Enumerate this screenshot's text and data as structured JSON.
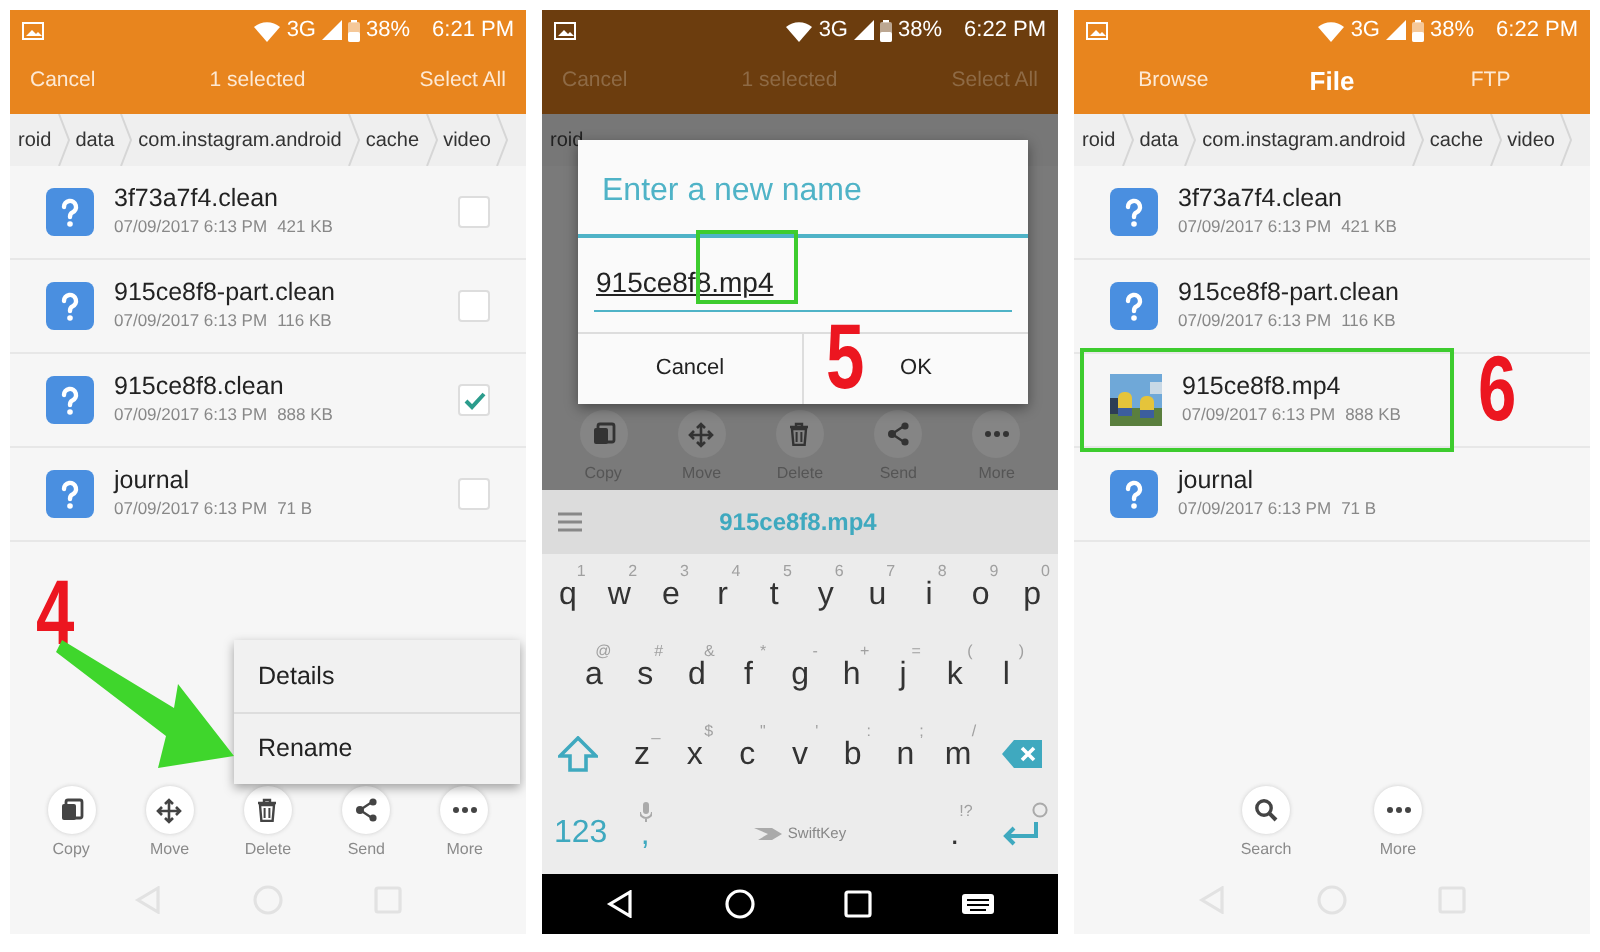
{
  "panels": [
    {
      "kind": "selection",
      "step": "4",
      "status_bar": {
        "network": "3G",
        "battery": "38%",
        "time": "6:21 PM"
      },
      "app_bar": {
        "left": "Cancel",
        "title": "1 selected",
        "right": "Select All"
      },
      "breadcrumb": [
        "roid",
        "data",
        "com.instagram.android",
        "cache",
        "video"
      ],
      "files": [
        {
          "name": "3f73a7f4.clean",
          "date": "07/09/2017 6:13 PM",
          "size": "421 KB",
          "kind": "unknown",
          "checked": false
        },
        {
          "name": "915ce8f8-part.clean",
          "date": "07/09/2017 6:13 PM",
          "size": "116 KB",
          "kind": "unknown",
          "checked": false
        },
        {
          "name": "915ce8f8.clean",
          "date": "07/09/2017 6:13 PM",
          "size": "888 KB",
          "kind": "unknown",
          "checked": true
        },
        {
          "name": "journal",
          "date": "07/09/2017 6:13 PM",
          "size": "71 B",
          "kind": "unknown",
          "checked": false
        }
      ],
      "context_menu": [
        "Details",
        "Rename"
      ],
      "toolbar": [
        {
          "kind": "copy",
          "label": "Copy"
        },
        {
          "kind": "move",
          "label": "Move"
        },
        {
          "kind": "delete",
          "label": "Delete"
        },
        {
          "kind": "send",
          "label": "Send"
        },
        {
          "kind": "more",
          "label": "More"
        }
      ]
    },
    {
      "kind": "rename",
      "step": "5",
      "status_bar": {
        "network": "3G",
        "battery": "38%",
        "time": "6:22 PM"
      },
      "app_bar": {
        "left": "Cancel",
        "title": "1 selected",
        "right": "Select All"
      },
      "breadcrumb": [
        "roid"
      ],
      "dialog": {
        "title": "Enter a new name",
        "value": "915ce8f8.mp4",
        "highlighted": true,
        "buttons": [
          "Cancel",
          "OK"
        ]
      },
      "toolbar": [
        {
          "kind": "copy",
          "label": "Copy"
        },
        {
          "kind": "move",
          "label": "Move"
        },
        {
          "kind": "delete",
          "label": "Delete"
        },
        {
          "kind": "send",
          "label": "Send"
        },
        {
          "kind": "more",
          "label": "More"
        }
      ],
      "keyboard": {
        "suggestion": "915ce8f8.mp4",
        "rows": [
          {
            "keys": [
              {
                "kind": "char",
                "label": "q",
                "hint": "1"
              },
              {
                "kind": "char",
                "label": "w",
                "hint": "2"
              },
              {
                "kind": "char",
                "label": "e",
                "hint": "3"
              },
              {
                "kind": "char",
                "label": "r",
                "hint": "4"
              },
              {
                "kind": "char",
                "label": "t",
                "hint": "5"
              },
              {
                "kind": "char",
                "label": "y",
                "hint": "6"
              },
              {
                "kind": "char",
                "label": "u",
                "hint": "7"
              },
              {
                "kind": "char",
                "label": "i",
                "hint": "8"
              },
              {
                "kind": "char",
                "label": "o",
                "hint": "9"
              },
              {
                "kind": "char",
                "label": "p",
                "hint": "0"
              }
            ]
          },
          {
            "keys": [
              {
                "kind": "char",
                "label": "a",
                "hint": "@"
              },
              {
                "kind": "char",
                "label": "s",
                "hint": "#"
              },
              {
                "kind": "char",
                "label": "d",
                "hint": "&"
              },
              {
                "kind": "char",
                "label": "f",
                "hint": "*"
              },
              {
                "kind": "char",
                "label": "g",
                "hint": "-"
              },
              {
                "kind": "char",
                "label": "h",
                "hint": "+"
              },
              {
                "kind": "char",
                "label": "j",
                "hint": "="
              },
              {
                "kind": "char",
                "label": "k",
                "hint": "("
              },
              {
                "kind": "char",
                "label": "l",
                "hint": ")"
              }
            ]
          },
          {
            "keys": [
              {
                "kind": "shift"
              },
              {
                "kind": "char",
                "label": "z",
                "hint": "_"
              },
              {
                "kind": "char",
                "label": "x",
                "hint": "$"
              },
              {
                "kind": "char",
                "label": "c",
                "hint": "\""
              },
              {
                "kind": "char",
                "label": "v",
                "hint": "'"
              },
              {
                "kind": "char",
                "label": "b",
                "hint": ":"
              },
              {
                "kind": "char",
                "label": "n",
                "hint": ";"
              },
              {
                "kind": "char",
                "label": "m",
                "hint": "/"
              },
              {
                "kind": "backspace"
              }
            ]
          },
          {
            "keys": [
              {
                "kind": "mode",
                "label": "123"
              },
              {
                "kind": "comma",
                "label": ","
              },
              {
                "kind": "space",
                "label": "SwiftKey"
              },
              {
                "kind": "char",
                "label": ".",
                "hint": "!?"
              },
              {
                "kind": "enter"
              }
            ]
          }
        ]
      }
    },
    {
      "kind": "browse",
      "step": "6",
      "status_bar": {
        "network": "3G",
        "battery": "38%",
        "time": "6:22 PM"
      },
      "tabs": [
        {
          "label": "Browse",
          "selected": false
        },
        {
          "label": "File",
          "selected": true
        },
        {
          "label": "FTP",
          "selected": false
        }
      ],
      "breadcrumb": [
        "roid",
        "data",
        "com.instagram.android",
        "cache",
        "video"
      ],
      "files": [
        {
          "name": "3f73a7f4.clean",
          "date": "07/09/2017 6:13 PM",
          "size": "421 KB",
          "kind": "unknown",
          "highlighted": false
        },
        {
          "name": "915ce8f8-part.clean",
          "date": "07/09/2017 6:13 PM",
          "size": "116 KB",
          "kind": "unknown",
          "highlighted": false
        },
        {
          "name": "915ce8f8.mp4",
          "date": "07/09/2017 6:13 PM",
          "size": "888 KB",
          "kind": "video",
          "highlighted": true
        },
        {
          "name": "journal",
          "date": "07/09/2017 6:13 PM",
          "size": "71 B",
          "kind": "unknown",
          "highlighted": false
        }
      ],
      "toolbar": [
        {
          "kind": "search",
          "label": "Search"
        },
        {
          "kind": "more",
          "label": "More"
        }
      ]
    }
  ]
}
